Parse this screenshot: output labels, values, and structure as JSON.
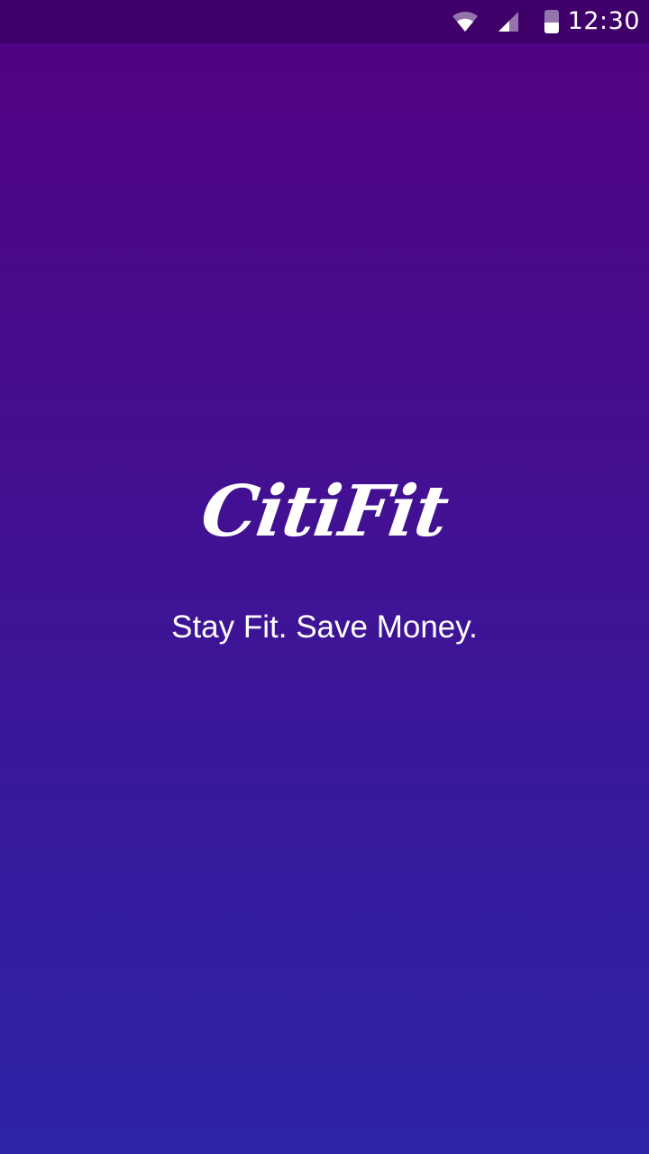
{
  "status_bar": {
    "time": "12:30",
    "icons": [
      "wifi-icon",
      "cellular-signal-icon",
      "battery-icon"
    ],
    "background": "#3f0169"
  },
  "splash": {
    "logo_text": "CitiFit",
    "tagline": "Stay Fit. Save Money.",
    "gradient_top": "#530183",
    "gradient_bottom": "#2d24a6"
  }
}
